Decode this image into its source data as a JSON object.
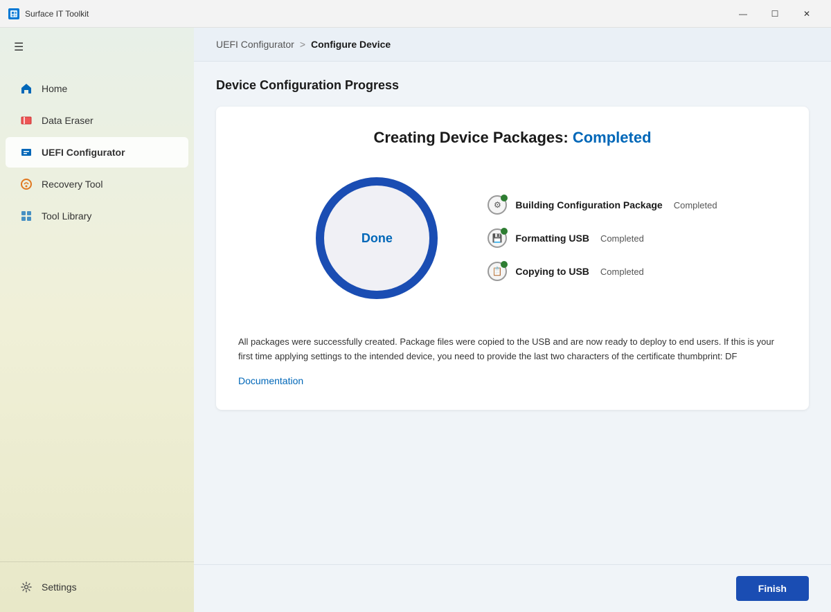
{
  "titleBar": {
    "appName": "Surface IT Toolkit",
    "controls": {
      "minimize": "—",
      "maximize": "☐",
      "close": "✕"
    }
  },
  "sidebar": {
    "hamburgerLabel": "☰",
    "navItems": [
      {
        "id": "home",
        "label": "Home",
        "icon": "home-icon"
      },
      {
        "id": "data-eraser",
        "label": "Data Eraser",
        "icon": "data-eraser-icon"
      },
      {
        "id": "uefi-configurator",
        "label": "UEFI Configurator",
        "icon": "uefi-icon",
        "active": true
      },
      {
        "id": "recovery-tool",
        "label": "Recovery Tool",
        "icon": "recovery-icon"
      },
      {
        "id": "tool-library",
        "label": "Tool Library",
        "icon": "tool-library-icon"
      }
    ],
    "footer": {
      "settings": {
        "label": "Settings",
        "icon": "settings-icon"
      }
    }
  },
  "breadcrumb": {
    "parent": "UEFI Configurator",
    "separator": ">",
    "current": "Configure Device"
  },
  "page": {
    "sectionTitle": "Device Configuration Progress",
    "completionHeading": {
      "prefix": "Creating Device Packages:",
      "status": "Completed"
    },
    "circleLabel": "Done",
    "steps": [
      {
        "name": "Building Configuration Package",
        "status": "Completed",
        "icon": "⚙"
      },
      {
        "name": "Formatting USB",
        "status": "Completed",
        "icon": "💾"
      },
      {
        "name": "Copying to USB",
        "status": "Completed",
        "icon": "📋"
      }
    ],
    "infoText": "All packages were successfully created. Package files were copied to the USB and are now ready to deploy to end users. If this is your first time applying settings to the intended device, you need to provide the last two characters of the certificate thumbprint: DF",
    "docLink": "Documentation",
    "finishButton": "Finish"
  }
}
